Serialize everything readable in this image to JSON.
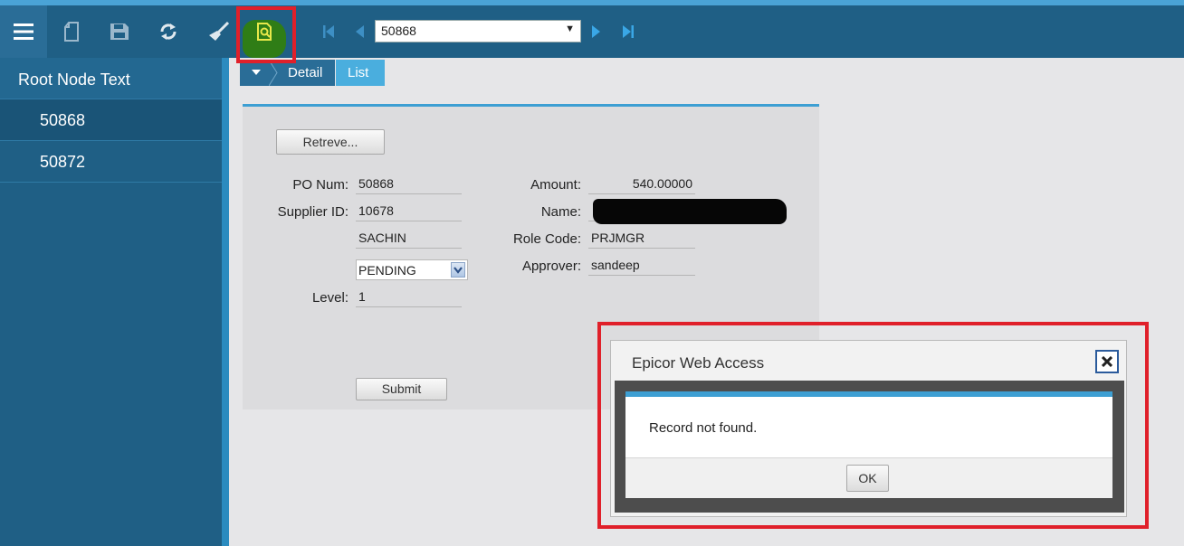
{
  "toolbar": {
    "icons": [
      "menu-icon",
      "new-icon",
      "save-icon",
      "refresh-icon",
      "clear-icon",
      "search-icon",
      "first-icon",
      "previous-icon",
      "next-icon",
      "last-icon"
    ],
    "record_value": "50868",
    "accent_color": "#4aa3d6",
    "toolbar_color": "#1f5f85"
  },
  "sidebar": {
    "root_label": "Root Node Text",
    "items": [
      {
        "label": "50868"
      },
      {
        "label": "50872"
      }
    ]
  },
  "tabs": {
    "detail": "Detail",
    "list": "List"
  },
  "form": {
    "retrieve_button": "Retreve...",
    "po_num_label": "PO Num:",
    "po_num_value": "50868",
    "supplier_label": "Supplier ID:",
    "supplier_value": "10678",
    "supplier_name_value": "SACHIN",
    "status_value": "PENDING",
    "level_label": "Level:",
    "level_value": "1",
    "amount_label": "Amount:",
    "amount_value": "540.00000",
    "name_label": "Name:",
    "role_label": "Role Code:",
    "role_value": "PRJMGR",
    "approver_label": "Approver:",
    "approver_value": "sandeep",
    "submit_button": "Submit"
  },
  "dialog": {
    "title": "Epicor Web Access",
    "message": "Record not found.",
    "ok_button": "OK"
  }
}
